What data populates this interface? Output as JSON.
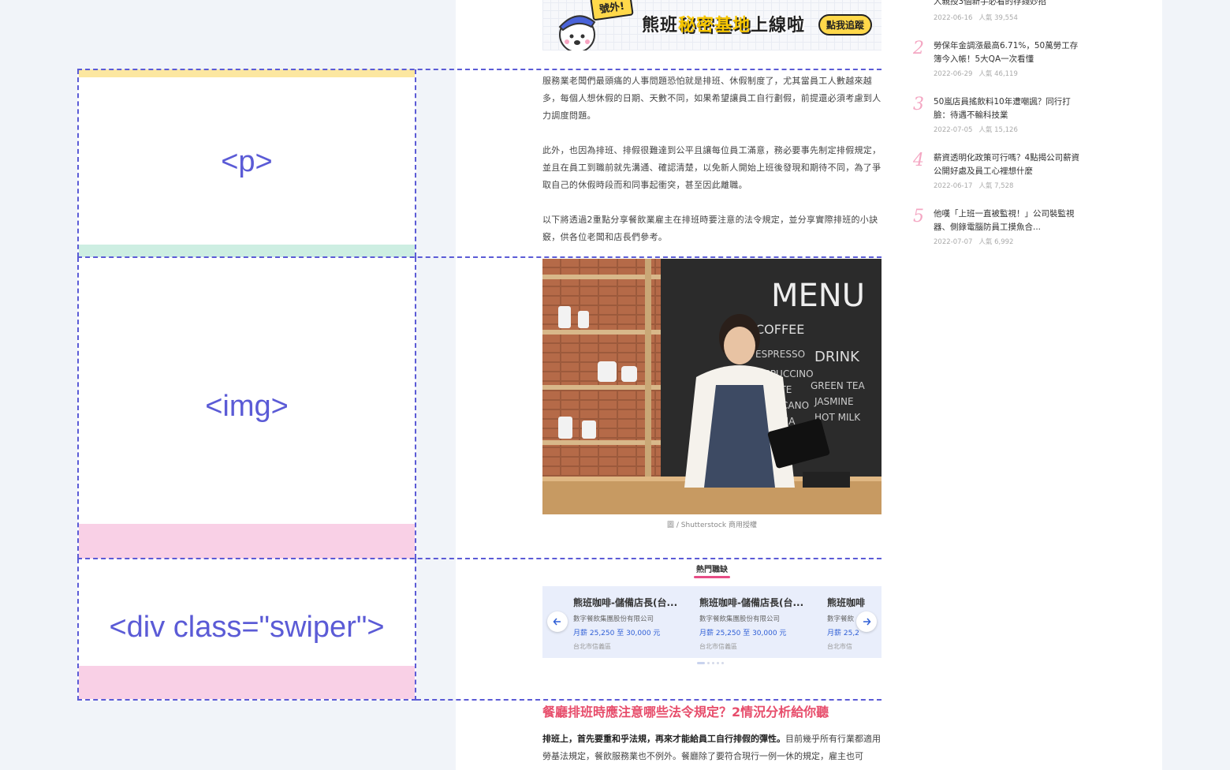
{
  "banner": {
    "tag": "號外!",
    "title_part1": "熊班",
    "title_highlight": "秘密基地",
    "title_part2": "上線啦",
    "button": "點我追蹤"
  },
  "annotations": {
    "p_label": "<p>",
    "img_label": "<img>",
    "swiper_label": "<div class=\"swiper\">"
  },
  "article": {
    "paragraphs": [
      "服務業老闆們最頭痛的人事問題恐怕就是排班、休假制度了，尤其當員工人數越來越多，每個人想休假的日期、天數不同，如果希望讓員工自行劃假，前提還必須考慮到人力調度問題。",
      "此外，也因為排班、排假很難達到公平且讓每位員工滿意，務必要事先制定排假規定，並且在員工到職前就先溝通、確認清楚，以免新人開始上班後發現和期待不同，為了爭取自己的休假時段而和同事起衝突，甚至因此離職。",
      "以下將透過2重點分享餐飲業雇主在排班時要注意的法令規定，並分享實際排班的小訣竅，供各位老闆和店長們參考。"
    ],
    "photo_caption": "圖 / Shutterstock 商用授權",
    "hot_jobs_title": "熱門職缺",
    "jobs": [
      {
        "title": "熊班咖啡-儲備店長(台...",
        "company": "數字餐飲集團股份有限公司",
        "salary": "月薪 25,250 至 30,000 元",
        "location": "台北市信義區"
      },
      {
        "title": "熊班咖啡-儲備店長(台...",
        "company": "數字餐飲集團股份有限公司",
        "salary": "月薪 25,250 至 30,000 元",
        "location": "台北市信義區"
      },
      {
        "title": "熊班咖啡",
        "company": "數字餐飲",
        "salary": "月薪 25,2",
        "location": "台北市信"
      }
    ],
    "section_heading": "餐廳排班時應注意哪些法令規定？2情況分析給你聽",
    "section_lead_bold": "排班上，首先要重和乎法規，再來才能給員工自行排假的彈性。",
    "section_lead_rest": "目前幾乎所有行業都適用勞基法規定，餐飲服務業也不例外。餐廳除了要符合現行一例一休的規定，雇主也可"
  },
  "sidebar": {
    "views_label": "人氣",
    "items": [
      {
        "num": "1",
        "title": "人親授3個新手必看的存錢妙招",
        "date": "2022-06-16",
        "views": "39,554"
      },
      {
        "num": "2",
        "title": "勞保年金調漲最高6.71%，50萬勞工存簿今入帳！5大QA一次看懂",
        "date": "2022-06-29",
        "views": "46,119"
      },
      {
        "num": "3",
        "title": "50嵐店員搖飲料10年遭嘲諷？同行打臉：待遇不輸科技業",
        "date": "2022-07-05",
        "views": "15,126"
      },
      {
        "num": "4",
        "title": "薪資透明化政策可行嗎？4點揭公司薪資公開好處及員工心裡想什麼",
        "date": "2022-06-17",
        "views": "7,528"
      },
      {
        "num": "5",
        "title": "他嘆「上班一直被監視！」公司裝監視器、側錄電腦防員工摸魚合...",
        "date": "2022-07-07",
        "views": "6,992"
      }
    ]
  },
  "colors": {
    "annotation": "#5b5bd6",
    "band_yellow": "#fce7a0",
    "band_green": "#cdeee2",
    "band_pink": "#f9d0e6",
    "rank_pink": "#f4a7c3",
    "heading_red": "#e74d6b",
    "salary_blue": "#2f5fd6"
  }
}
